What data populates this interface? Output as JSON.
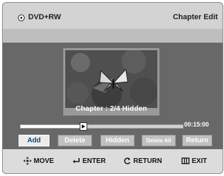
{
  "header": {
    "disc_label": "DVD+RW",
    "screen_title": "Chapter Edit"
  },
  "preview": {
    "caption": "Chapter : 2/4 Hidden"
  },
  "progress": {
    "position_fraction": 0.38,
    "duration": "00:15:00"
  },
  "buttons": [
    {
      "label": "Add",
      "selected": true
    },
    {
      "label": "Delete",
      "selected": false
    },
    {
      "label": "Hidden",
      "selected": false
    },
    {
      "label": "Delete All",
      "selected": false
    },
    {
      "label": "Return",
      "selected": false
    }
  ],
  "footer": {
    "move": "MOVE",
    "enter": "ENTER",
    "return": "RETURN",
    "exit": "EXIT",
    "icons": [
      "four-way-arrows-icon",
      "enter-key-icon",
      "return-arrow-icon",
      "menu-exit-icon"
    ]
  },
  "colors": {
    "accent_selected_text": "#0f3f85",
    "panel_background": "#666666",
    "button_background": "#c0c0c0"
  }
}
